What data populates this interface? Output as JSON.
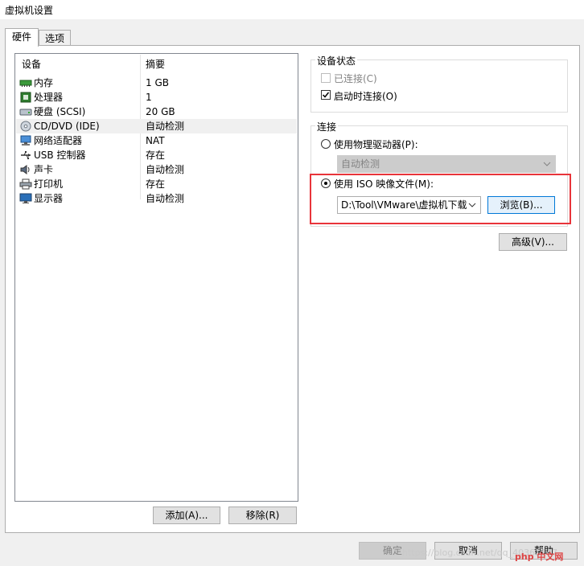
{
  "window": {
    "title": "虚拟机设置"
  },
  "tabs": [
    {
      "label": "硬件"
    },
    {
      "label": "选项"
    }
  ],
  "devices": {
    "headers": {
      "device": "设备",
      "summary": "摘要"
    },
    "rows": [
      {
        "icon": "memory-icon",
        "name": "内存",
        "summary": "1 GB"
      },
      {
        "icon": "processor-icon",
        "name": "处理器",
        "summary": "1"
      },
      {
        "icon": "harddisk-icon",
        "name": "硬盘 (SCSI)",
        "summary": "20 GB"
      },
      {
        "icon": "cd-dvd-icon",
        "name": "CD/DVD (IDE)",
        "summary": "自动检测"
      },
      {
        "icon": "network-adapter-icon",
        "name": "网络适配器",
        "summary": "NAT"
      },
      {
        "icon": "usb-icon",
        "name": "USB 控制器",
        "summary": "存在"
      },
      {
        "icon": "sound-card-icon",
        "name": "声卡",
        "summary": "自动检测"
      },
      {
        "icon": "printer-icon",
        "name": "打印机",
        "summary": "存在"
      },
      {
        "icon": "display-icon",
        "name": "显示器",
        "summary": "自动检测"
      }
    ],
    "selected_index": 3,
    "add_button": "添加(A)...",
    "remove_button": "移除(R)"
  },
  "device_status": {
    "title": "设备状态",
    "connected": {
      "label": "已连接(C)",
      "checked": false,
      "enabled": false
    },
    "connect_at_power_on": {
      "label": "启动时连接(O)",
      "checked": true
    }
  },
  "connection": {
    "title": "连接",
    "physical": {
      "label": "使用物理驱动器(P):",
      "selected": false,
      "drive_value": "自动检测"
    },
    "iso": {
      "label": "使用 ISO 映像文件(M):",
      "selected": true,
      "path_value": "D:\\Tool\\VMware\\虚拟机下载",
      "browse_button": "浏览(B)..."
    }
  },
  "advanced_button": "高级(V)...",
  "footer": {
    "ok": "确定",
    "cancel": "取消",
    "help": "帮助"
  },
  "watermark": {
    "text": "https://blog.csdn.net/qq_40361147",
    "logo": "php 中文网"
  },
  "colors": {
    "highlight": "#e8343a",
    "selection_row": "#f0f0f0",
    "primary_button_border": "#0078d7"
  }
}
